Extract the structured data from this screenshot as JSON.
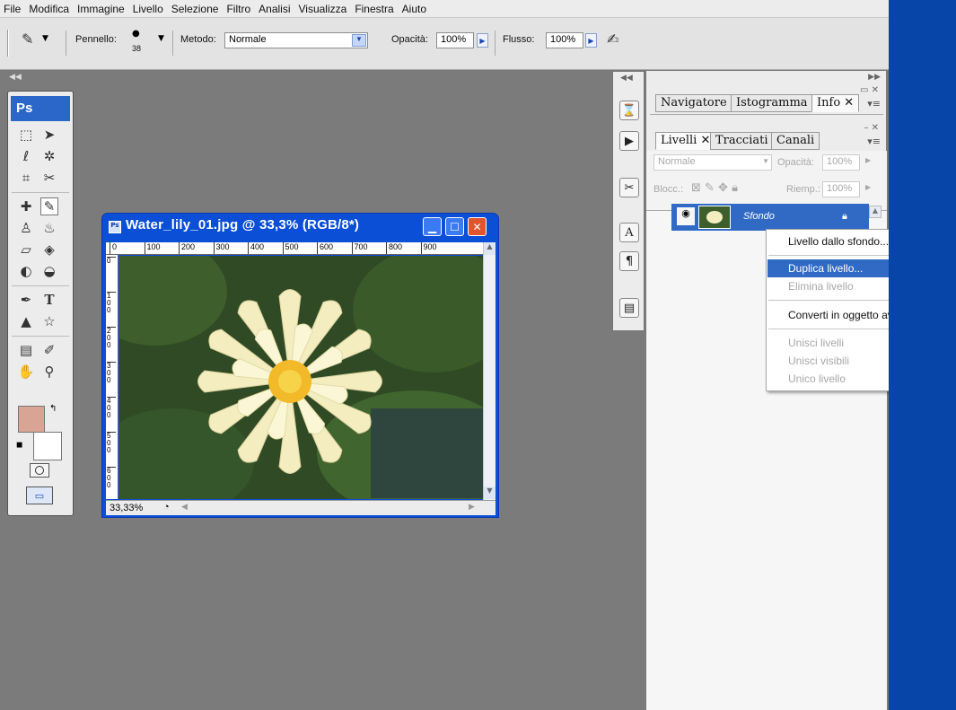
{
  "menubar": {
    "items": [
      "File",
      "Modifica",
      "Immagine",
      "Livello",
      "Selezione",
      "Filtro",
      "Analisi",
      "Visualizza",
      "Finestra",
      "Aiuto"
    ]
  },
  "options": {
    "brush_label": "Pennello:",
    "brush_size": "38",
    "method_label": "Metodo:",
    "method_value": "Normale",
    "opacity_label": "Opacità:",
    "opacity_value": "100%",
    "flow_label": "Flusso:",
    "flow_value": "100%"
  },
  "toolbox": {
    "logo": "Ps",
    "foreground_color": "#d9a494",
    "background_color": "#ffffff"
  },
  "document": {
    "title": "Water_lily_01.jpg @ 33,3% (RGB/8*)",
    "zoom": "33,33%",
    "ruler_top": [
      "0",
      "100",
      "200",
      "300",
      "400",
      "500",
      "600",
      "700",
      "800",
      "900"
    ],
    "ruler_left": [
      "0",
      "100",
      "200",
      "300",
      "400",
      "500",
      "600"
    ]
  },
  "panels": {
    "top_tabs": [
      "Navigatore",
      "Istogramma",
      "Info"
    ],
    "layer_tabs": [
      "Livelli",
      "Tracciati",
      "Canali"
    ],
    "blend_mode": "Normale",
    "opacity_label": "Opacità:",
    "opacity_value": "100%",
    "lock_label": "Blocc.:",
    "fill_label": "Riemp.:",
    "fill_value": "100%",
    "layer_name": "Sfondo"
  },
  "context_menu": {
    "items": [
      {
        "label": "Livello dallo sfondo..."
      },
      {
        "label": "Duplica livello..."
      },
      {
        "label": "Elimina livello"
      },
      {
        "label": "Converti in oggetto avanzato"
      },
      {
        "label": "Unisci livelli"
      },
      {
        "label": "Unisci visibili"
      },
      {
        "label": "Unico livello"
      }
    ]
  },
  "colors": {
    "accent": "#0a4fd6",
    "menu_highlight": "#316ac5",
    "desktop": "#0845a8"
  }
}
